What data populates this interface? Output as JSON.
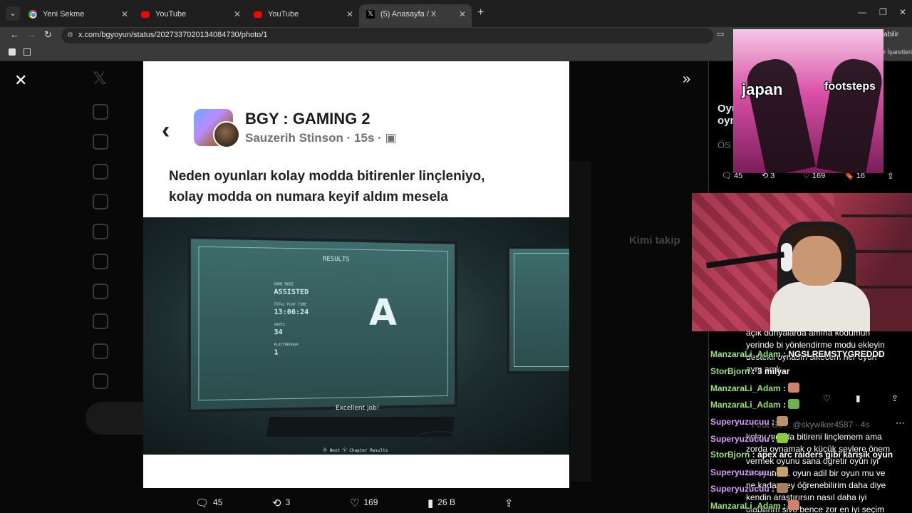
{
  "browser": {
    "tabs": [
      {
        "title": "Yeni Sekme",
        "favicon": "chrome-icon",
        "active": false
      },
      {
        "title": "YouTube",
        "favicon": "youtube-icon",
        "active": false
      },
      {
        "title": "YouTube",
        "favicon": "youtube-icon",
        "active": false
      },
      {
        "title": "(5) Anasayfa / X",
        "favicon": "x-icon",
        "active": true
      }
    ],
    "url": "x.com/bgyoyun/status/2027337020134084730/photo/1",
    "bookmark_partial_right": "r İşaretleri",
    "extension_partial": "abilir"
  },
  "photo": {
    "group_name": "BGY : GAMING 2",
    "author": "Sauzerih Stinson",
    "time": "15s",
    "text_line1": "Neden oyunları kolay modda bitirenler linçleniyo,",
    "text_line2": "kolay modda on numara keyif aldım mesela",
    "game": {
      "header": "RESULTS",
      "mode_label": "GAME MODE",
      "mode_value": "ASSISTED",
      "time_label": "TOTAL PLAY TIME",
      "time_value": "13:06:24",
      "saves_label": "SAVES",
      "saves_value": "34",
      "playthrough_label": "PLAYTHROUGH",
      "playthrough_value": "1",
      "grade": "A",
      "message": "Excellent job!",
      "footer": "Ⓐ Next   Ⓨ Chapter Results"
    }
  },
  "actions": {
    "replies": "45",
    "reposts": "3",
    "likes": "169",
    "views": "26 B"
  },
  "right_column": {
    "reply_count": "45",
    "repost_count": "3",
    "like_count": "169",
    "bookmark_count": "16",
    "partial_title_1": "Oyu",
    "partial_title_2": "oyn",
    "partial_os": "ÖS",
    "who_to_follow_partial": "Kimi takip",
    "reply_user": "@skywlker4587 · 4s",
    "reply_user_prefix": "Fırat Gö..."
  },
  "chat": {
    "overlay_text": [
      "açık dünyalarda amına kodumun",
      "yerinde bi yönlendirme modu ekleyin",
      "destekli oynasın sikecem her oyun",
      "aynı amk"
    ],
    "lines": [
      {
        "name": "ManzaraLi_Adam",
        "message": "NGSLREMSTYGREDDD"
      },
      {
        "name": "StorBjorn",
        "message": "3 milyar"
      },
      {
        "name": "ManzaraLi_Adam",
        "message": ""
      },
      {
        "name": "ManzaraLi_Adam",
        "message": ""
      },
      {
        "name": "Superyuzucuu",
        "message": ""
      },
      {
        "name": "Superyuzucuu",
        "message": ""
      },
      {
        "name": "StorBjorn",
        "message": "apex arc raiders gibi karışık oyun"
      },
      {
        "name": "Superyuzucuu",
        "message": ""
      },
      {
        "name": "Superyuzucuu",
        "message": ""
      },
      {
        "name": "ManzaraLi_Adam",
        "message": ""
      }
    ],
    "reply_text": [
      "kolay modda bitireni linçlemem ama",
      "zorda oynamak o küçük şeylere önem",
      "vermek oyunu sana öğretir oyun iyi",
      "bir oyunsa.. oyun adil bir oyun mu ve",
      "ne kadar şey öğrenebilirim daha diye",
      "kendin araştırırsın nasıl  daha iyi",
      "olabilirim sivo bence zor en iyi seçim"
    ]
  },
  "overlay_meme": {
    "left_label": "japan",
    "right_label": "footsteps"
  },
  "colors": {
    "chat_name_green": "#9be27a",
    "chat_name_purple": "#d99bff",
    "page_bg": "#080808"
  }
}
